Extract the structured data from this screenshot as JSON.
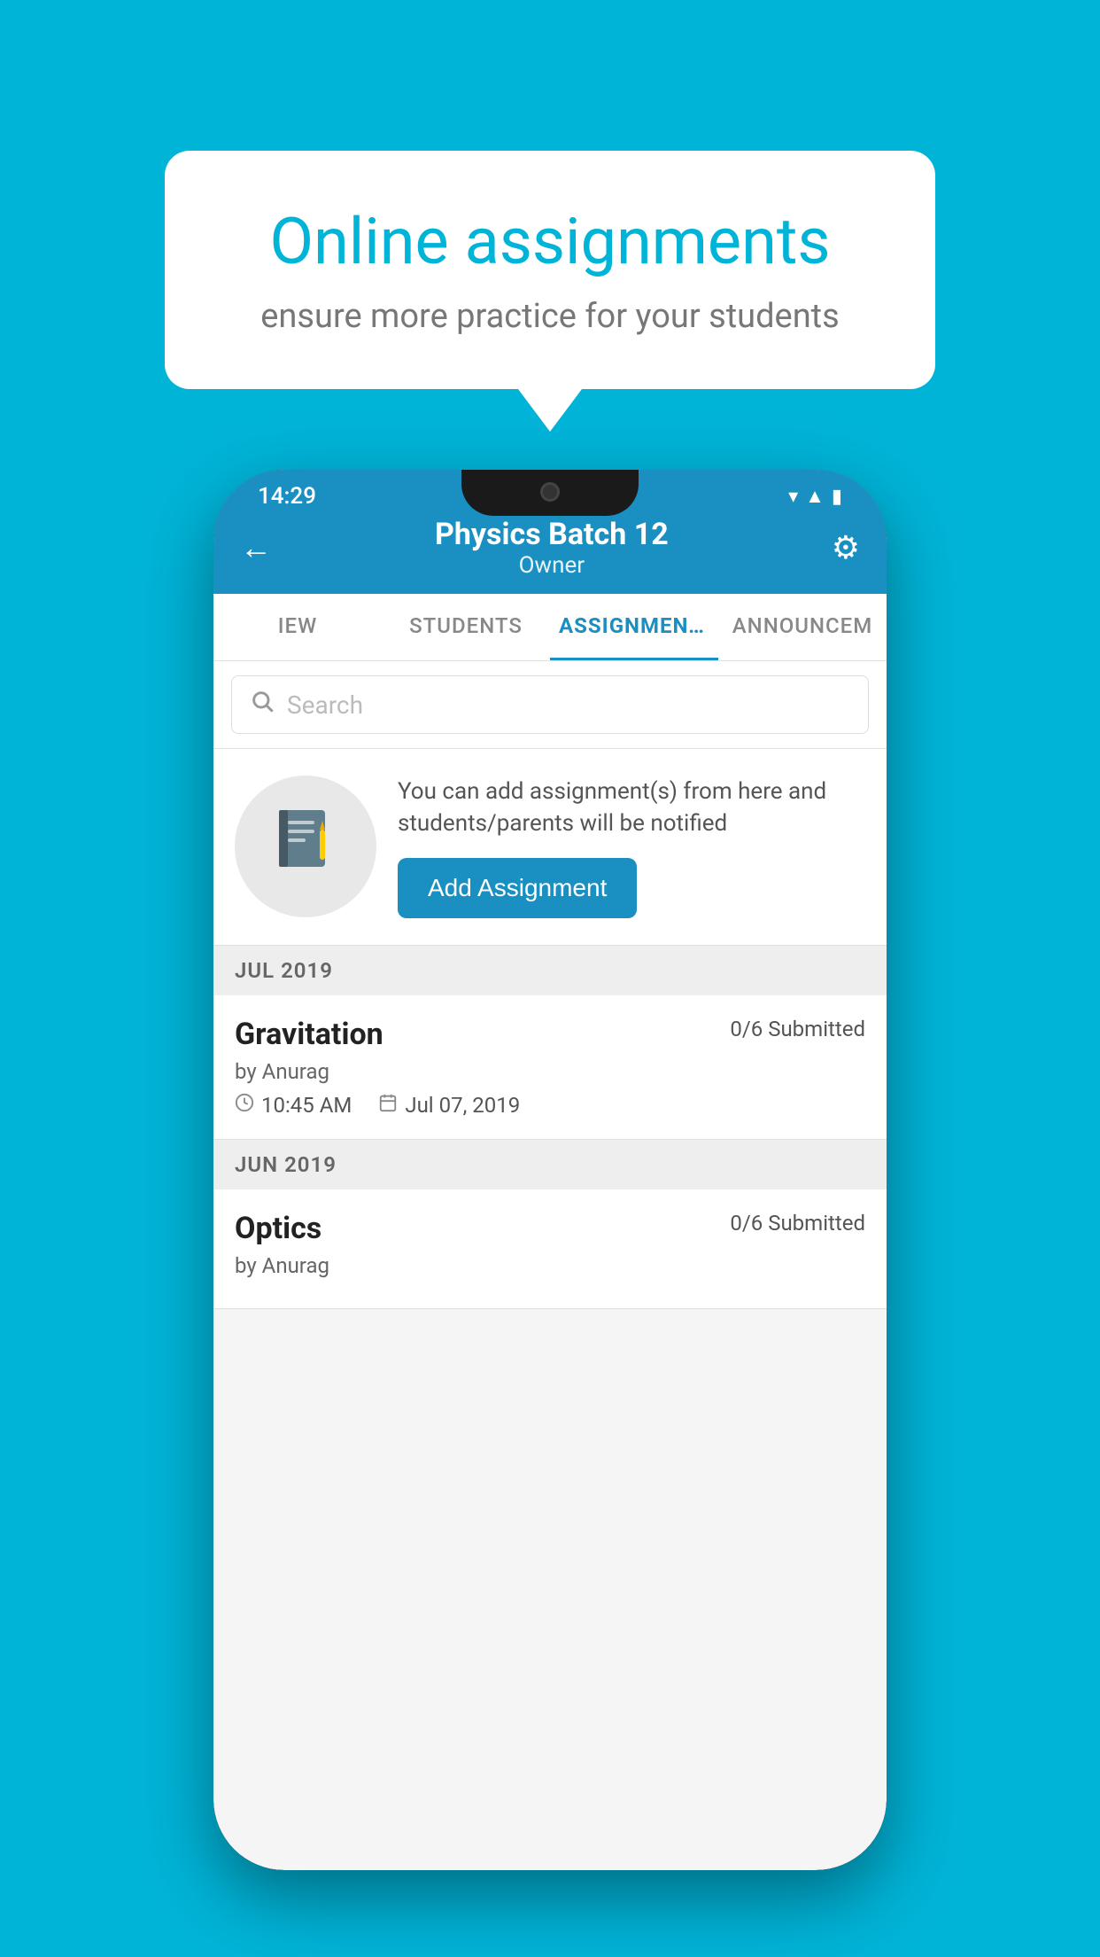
{
  "background_color": "#00b4d8",
  "speech_bubble": {
    "title": "Online assignments",
    "subtitle": "ensure more practice for your students"
  },
  "status_bar": {
    "time": "14:29",
    "icons": [
      "wifi",
      "signal",
      "battery"
    ]
  },
  "header": {
    "title": "Physics Batch 12",
    "subtitle": "Owner"
  },
  "tabs": [
    {
      "label": "IEW",
      "active": false
    },
    {
      "label": "STUDENTS",
      "active": false
    },
    {
      "label": "ASSIGNMENTS",
      "active": true
    },
    {
      "label": "ANNOUNCEM",
      "active": false
    }
  ],
  "search": {
    "placeholder": "Search"
  },
  "promo": {
    "description": "You can add assignment(s) from here and students/parents will be notified",
    "button_label": "Add Assignment"
  },
  "sections": [
    {
      "label": "JUL 2019",
      "assignments": [
        {
          "name": "Gravitation",
          "submitted": "0/6 Submitted",
          "by": "by Anurag",
          "time": "10:45 AM",
          "date": "Jul 07, 2019"
        }
      ]
    },
    {
      "label": "JUN 2019",
      "assignments": [
        {
          "name": "Optics",
          "submitted": "0/6 Submitted",
          "by": "by Anurag",
          "time": "",
          "date": ""
        }
      ]
    }
  ]
}
